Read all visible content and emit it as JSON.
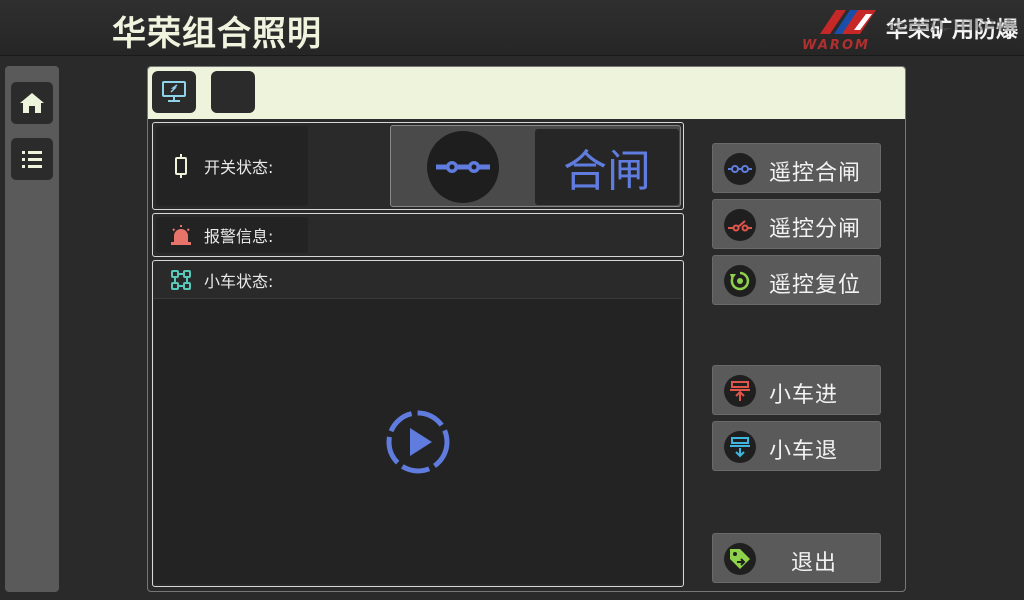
{
  "header": {
    "title": "华荣组合照明",
    "brand_name": "华荣矿用防爆",
    "brand_sub": "WAROM"
  },
  "left_rail": {
    "items": [
      {
        "icon": "home-icon"
      },
      {
        "icon": "list-icon"
      }
    ]
  },
  "toolbar": {
    "items": [
      {
        "icon": "monitor-icon"
      },
      {
        "icon": "blank"
      }
    ]
  },
  "switch_status": {
    "label": "开关状态:",
    "icon": "switch-icon",
    "indicator_icon": "switch-closed-icon",
    "value": "合闸",
    "value_color": "#5f7cde"
  },
  "alarm_info": {
    "label": "报警信息:",
    "icon": "alarm-light-icon",
    "value": ""
  },
  "cart_status": {
    "label": "小车状态:",
    "icon": "cart-nodes-icon",
    "video_icon": "play-icon"
  },
  "actions": {
    "remote_close": {
      "label": "遥控合闸",
      "icon": "switch-closed-icon",
      "color": "#5f7cde"
    },
    "remote_open": {
      "label": "遥控分闸",
      "icon": "switch-open-icon",
      "color": "#e0554a"
    },
    "remote_reset": {
      "label": "遥控复位",
      "icon": "reset-icon",
      "color": "#8ed14a"
    },
    "cart_in": {
      "label": "小车进",
      "icon": "cart-in-icon",
      "color": "#e0554a"
    },
    "cart_out": {
      "label": "小车退",
      "icon": "cart-out-icon",
      "color": "#3fb6e0"
    },
    "exit": {
      "label": "退出",
      "icon": "exit-tag-icon",
      "color": "#8ed14a"
    }
  }
}
